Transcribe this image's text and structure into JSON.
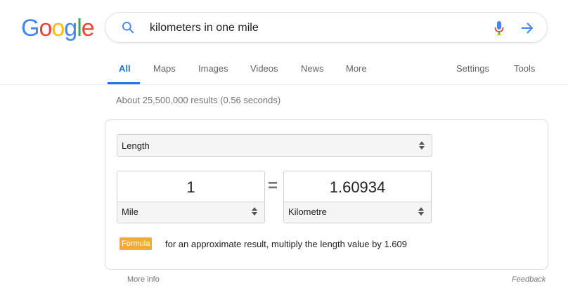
{
  "logo": {
    "letters": [
      {
        "char": "G",
        "color": "#4285f4"
      },
      {
        "char": "o",
        "color": "#ea4335"
      },
      {
        "char": "o",
        "color": "#fbbc05"
      },
      {
        "char": "g",
        "color": "#4285f4"
      },
      {
        "char": "l",
        "color": "#34a853"
      },
      {
        "char": "e",
        "color": "#ea4335"
      }
    ]
  },
  "search": {
    "query": "kilometers in one mile",
    "icons": [
      "search-icon",
      "mic-icon",
      "arrow-right-icon"
    ]
  },
  "tabs": [
    {
      "label": "All",
      "active": true
    },
    {
      "label": "Maps"
    },
    {
      "label": "Images"
    },
    {
      "label": "Videos"
    },
    {
      "label": "News"
    },
    {
      "label": "More"
    }
  ],
  "tools": [
    {
      "label": "Settings"
    },
    {
      "label": "Tools"
    }
  ],
  "result_stats": "About 25,500,000 results (0.56 seconds)",
  "converter": {
    "category": "Length",
    "equals_sign": "=",
    "from": {
      "value": "1",
      "unit": "Mile"
    },
    "to": {
      "value": "1.60934",
      "unit": "Kilometre"
    },
    "formula_badge": "Formula",
    "formula_text": "for an approximate result, multiply the length value by 1.609"
  },
  "footer": {
    "more_info": "More info",
    "feedback": "Feedback"
  },
  "colors": {
    "accent": "#1a73e8",
    "formula_badge": "#f4a939"
  }
}
